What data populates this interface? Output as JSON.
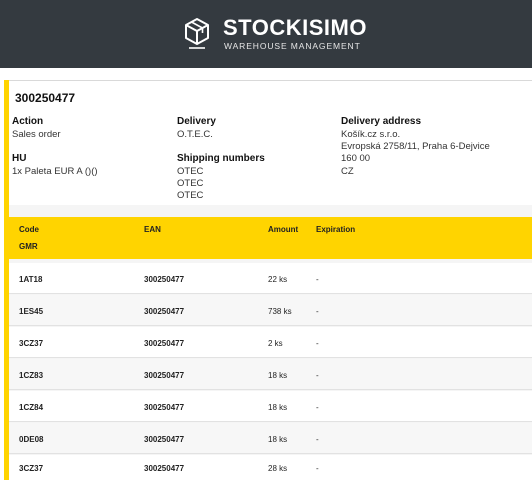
{
  "app": {
    "brand_title": "STOCKISIMO",
    "brand_subtitle": "WAREHOUSE MANAGEMENT",
    "logo_icon": "cube-icon"
  },
  "order": {
    "number": "300250477",
    "action_label": "Action",
    "action_value": "Sales order",
    "hu_label": "HU",
    "hu_value": "1x Paleta EUR A ()()",
    "delivery_label": "Delivery",
    "delivery_value": "O.T.E.C.",
    "shipping_label": "Shipping numbers",
    "shipping_numbers": [
      "OTEC",
      "OTEC",
      "OTEC"
    ],
    "address_label": "Delivery address",
    "address_lines": [
      "Košík.cz s.r.o.",
      "Evropská 2758/11, Praha 6-Dejvice",
      "160 00",
      "CZ"
    ]
  },
  "table": {
    "headers": {
      "code": "Code",
      "gmr": "GMR",
      "ean": "EAN",
      "amount": "Amount",
      "expiration": "Expiration"
    },
    "rows": [
      {
        "code": "1AT18",
        "ean": "300250477",
        "amount": "22 ks",
        "expiration": "-"
      },
      {
        "code": "1ES45",
        "ean": "300250477",
        "amount": "738 ks",
        "expiration": "-"
      },
      {
        "code": "3CZ37",
        "ean": "300250477",
        "amount": "2 ks",
        "expiration": "-"
      },
      {
        "code": "1CZ83",
        "ean": "300250477",
        "amount": "18 ks",
        "expiration": "-"
      },
      {
        "code": "1CZ84",
        "ean": "300250477",
        "amount": "18 ks",
        "expiration": "-"
      },
      {
        "code": "0DE08",
        "ean": "300250477",
        "amount": "18 ks",
        "expiration": "-"
      },
      {
        "code": "3CZ37",
        "ean": "300250477",
        "amount": "28 ks",
        "expiration": "-"
      }
    ]
  },
  "colors": {
    "header_bg": "#343a40",
    "accent": "#ffd400"
  }
}
